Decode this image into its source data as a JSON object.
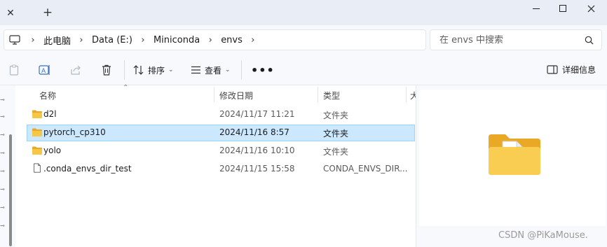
{
  "titlebar": {
    "tab_close_glyph": "✕",
    "new_tab_glyph": "+"
  },
  "address": {
    "crumbs": [
      "此电脑",
      "Data (E:)",
      "Miniconda",
      "envs"
    ],
    "separator": "›"
  },
  "search": {
    "placeholder": "在 envs 中搜索"
  },
  "toolbar": {
    "sort_label": "排序",
    "view_label": "查看",
    "more_label": "•••",
    "details_label": "详细信息"
  },
  "columns": {
    "name": "名称",
    "date": "修改日期",
    "type": "类型",
    "size": "大"
  },
  "files": [
    {
      "name": "d2l",
      "date": "2024/11/17 11:21",
      "type": "文件夹",
      "kind": "folder"
    },
    {
      "name": "pytorch_cp310",
      "date": "2024/11/16 8:57",
      "type": "文件夹",
      "kind": "folder",
      "selected": true
    },
    {
      "name": "yolo",
      "date": "2024/11/16 10:10",
      "type": "文件夹",
      "kind": "folder"
    },
    {
      "name": ".conda_envs_dir_test",
      "date": "2024/11/15 15:58",
      "type": "CONDA_ENVS_DIR...",
      "kind": "file"
    }
  ],
  "watermark": "CSDN @PiKaMouse.",
  "colors": {
    "folder": "#f3c23b",
    "selection": "#cce8ff",
    "selection_border": "#99d1ff"
  }
}
